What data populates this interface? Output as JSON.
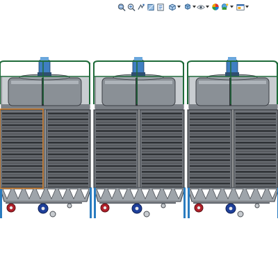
{
  "window": {
    "background": "#ffffff"
  },
  "toolbar": {
    "items": [
      {
        "icon": "zoom-to-fit-icon"
      },
      {
        "icon": "zoom-to-area-icon"
      },
      {
        "icon": "previous-view-icon"
      },
      {
        "icon": "section-view-icon"
      },
      {
        "icon": "dynamic-annotation-icon"
      },
      {
        "icon": "view-orientation-icon",
        "dropdown": true
      },
      {
        "icon": "display-style-icon",
        "dropdown": true
      },
      {
        "icon": "hide-show-items-icon",
        "dropdown": true
      },
      {
        "icon": "edit-appearance-icon"
      },
      {
        "icon": "apply-scene-icon",
        "dropdown": true
      },
      {
        "icon": "view-settings-icon",
        "dropdown": true
      }
    ]
  },
  "model": {
    "name": "cooling-tower-assembly",
    "cell_count": 3,
    "colors": {
      "louver": "#56595e",
      "louver_dark": "#2f3236",
      "casing": "#6e7278",
      "railing": "#1f6b3a",
      "fan_motor": "#3f7fc2",
      "fan_stack": "#8a9096",
      "column": "#2a7cc0",
      "pump_red": "#b0202a",
      "pump_blue": "#1e3f9a",
      "selection": "#d9822b"
    }
  }
}
